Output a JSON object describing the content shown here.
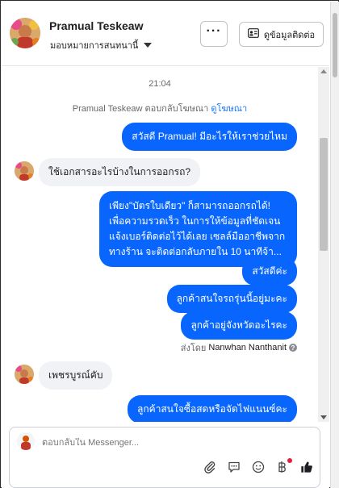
{
  "header": {
    "name": "Pramual Teskeaw",
    "assign_label": "มอบหมายการสนทนานี้",
    "more_label": "···",
    "contact_label": "ดูข้อมูลติดต่อ"
  },
  "thread": {
    "time": "21:04",
    "reply_note": "Pramual Teskeaw ตอบกลับโฆษณา",
    "reply_link": "ดูโฆษณา",
    "messages": [
      {
        "from": "page",
        "text": "สวัสดี Pramual! มีอะไรให้เราช่วยไหม"
      },
      {
        "from": "user",
        "text": "ใช้เอกสารอะไรบ้างในการออกรถ?"
      },
      {
        "from": "page",
        "text": "เพียง\"บัตรใบเดียว\" ก็สามารถออกรถได้! เพื่อความรวดเร็ว ในการให้ข้อมูลที่ชัดเจน แจ้งเบอร์ติดต่อไว้ได้เลย เซลล์มืออาชีพจากทางร้าน จะติดต่อกลับภายใน 10 นาทีจ้า..."
      },
      {
        "from": "page",
        "text": "สวัสดีค่ะ"
      },
      {
        "from": "page",
        "text": "ลูกค้าสนใจรถรุ่นนี้อยู่มะคะ"
      },
      {
        "from": "page",
        "text": "ลูกค้าอยู่จังหวัดอะไรคะ"
      },
      {
        "from": "user",
        "text": "เพชรบูรณ์คับ"
      },
      {
        "from": "page",
        "text": "ลูกค้าสนใจซื้อสดหรือจัดไฟแนนซ์คะ"
      }
    ],
    "sent_by_label": "ส่งโดย",
    "sent_by_name": "Nanwhan Nanthanit"
  },
  "composer": {
    "placeholder": "ตอบกลับใน Messenger..."
  },
  "icons": {
    "more": "more-icon",
    "contact": "contact-card-icon",
    "attach": "paperclip-icon",
    "saved_reply": "chat-bubble-icon",
    "emoji": "smiley-icon",
    "brand": "baht-icon",
    "like": "thumbs-up-icon"
  },
  "colors": {
    "accent": "#0866ff",
    "incoming_bubble": "#f0f2f5",
    "link": "#1877f2"
  }
}
